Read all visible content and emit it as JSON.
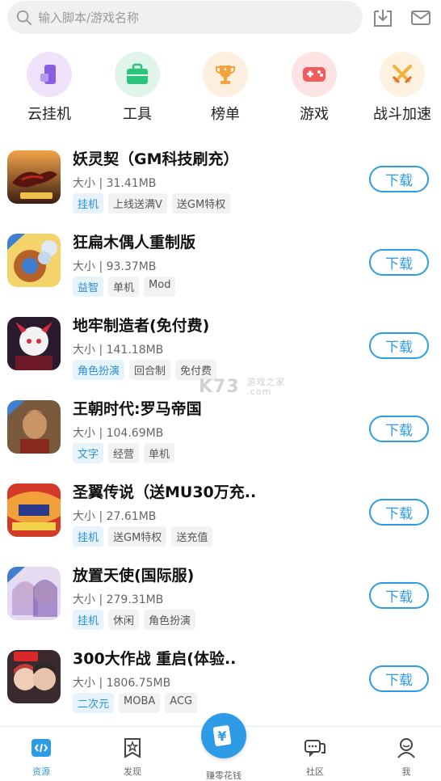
{
  "search": {
    "placeholder": "输入脚本/游戏名称"
  },
  "categories": [
    {
      "label": "云挂机",
      "icon": "cloud-phone-icon",
      "bg": "#efe3fb",
      "fg": "#8b5ce6"
    },
    {
      "label": "工具",
      "icon": "toolbox-icon",
      "bg": "#dff5ea",
      "fg": "#2cc37d"
    },
    {
      "label": "榜单",
      "icon": "trophy-icon",
      "bg": "#fdefe0",
      "fg": "#f2a33c"
    },
    {
      "label": "游戏",
      "icon": "gamepad-icon",
      "bg": "#fde3e3",
      "fg": "#f05b5b"
    },
    {
      "label": "战斗加速",
      "icon": "crossed-swords-icon",
      "bg": "#fdf1df",
      "fg": "#f3b23c"
    }
  ],
  "apps": [
    {
      "name": "妖灵契（GM科技刷充）",
      "size": "大小 | 31.41MB",
      "tags": [
        "挂机",
        "上线送满V",
        "送GM特权"
      ],
      "btn": "下载"
    },
    {
      "name": "狂扁木偶人重制版",
      "size": "大小 | 93.37MB",
      "tags": [
        "益智",
        "单机",
        "Mod"
      ],
      "btn": "下载"
    },
    {
      "name": "地牢制造者(免付费)",
      "size": "大小 | 141.18MB",
      "tags": [
        "角色扮演",
        "回合制",
        "免付费"
      ],
      "btn": "下载"
    },
    {
      "name": "王朝时代:罗马帝国",
      "size": "大小 | 104.69MB",
      "tags": [
        "文字",
        "经营",
        "单机"
      ],
      "btn": "下载"
    },
    {
      "name": "圣翼传说（送MU30万充..",
      "size": "大小 | 27.61MB",
      "tags": [
        "挂机",
        "送GM特权",
        "送充值"
      ],
      "btn": "下载"
    },
    {
      "name": "放置天使(国际服)",
      "size": "大小 | 279.31MB",
      "tags": [
        "挂机",
        "休闲",
        "角色扮演"
      ],
      "btn": "下载"
    },
    {
      "name": "300大作战  重启(体验..",
      "size": "大小 | 1806.75MB",
      "tags": [
        "二次元",
        "MOBA",
        "ACG"
      ],
      "btn": "下载"
    }
  ],
  "watermark": {
    "brand": "K73",
    "sub1": "游戏之家",
    "sub2": ".com"
  },
  "nav": {
    "resources": "资源",
    "discover": "发现",
    "earn": "赚零花钱",
    "community": "社区",
    "me": "我"
  },
  "colors": {
    "accent": "#2e9be6"
  }
}
